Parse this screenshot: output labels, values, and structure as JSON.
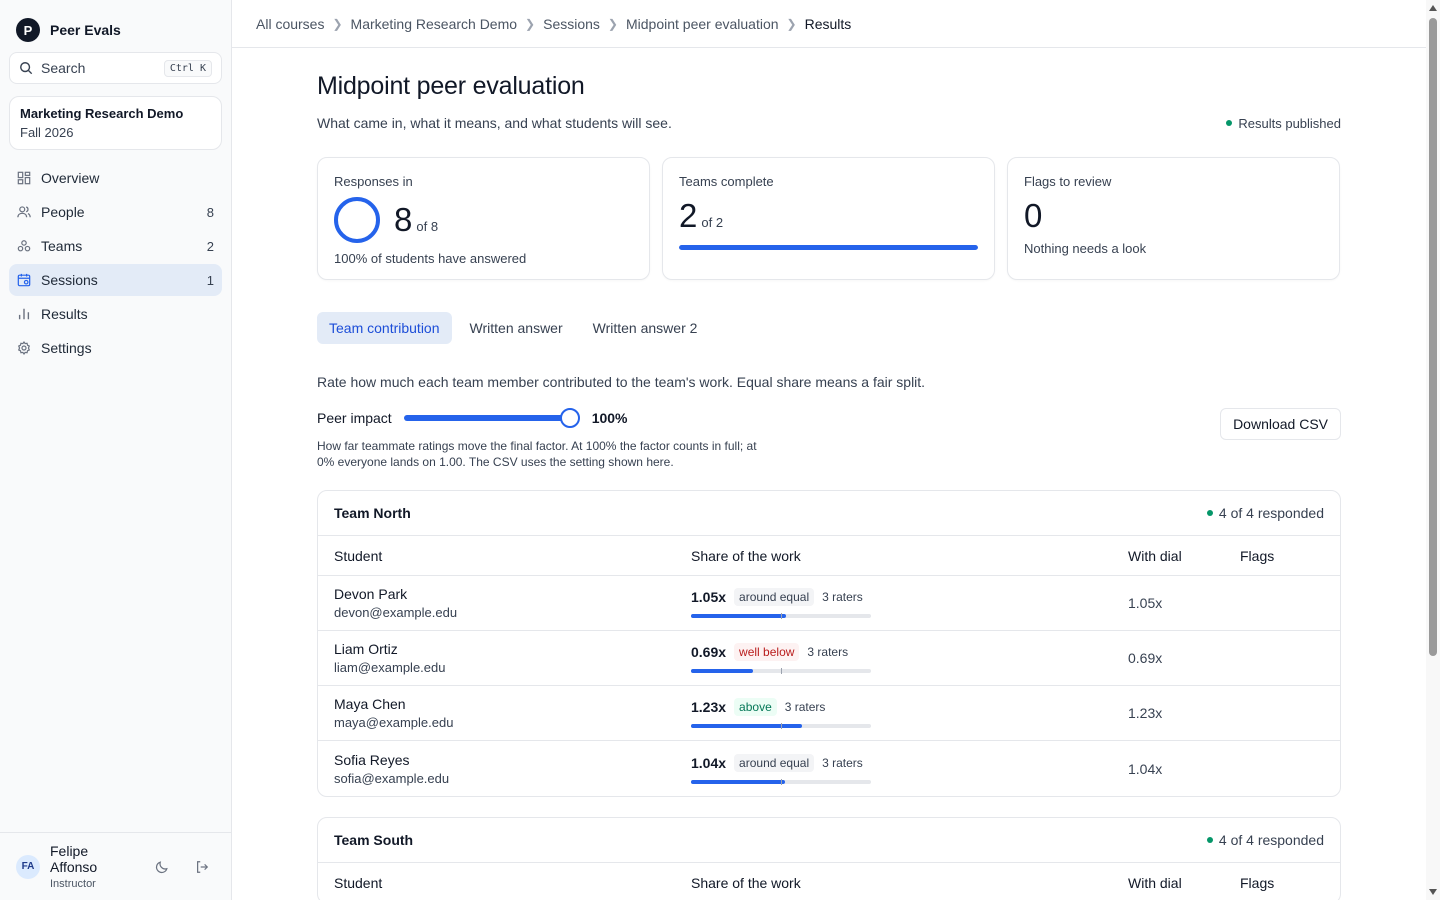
{
  "app": {
    "logo_letter": "P",
    "name": "Peer Evals"
  },
  "search": {
    "label": "Search",
    "shortcut": "Ctrl K"
  },
  "course": {
    "name": "Marketing Research Demo",
    "term": "Fall 2026"
  },
  "nav": [
    {
      "label": "Overview",
      "count": "",
      "icon": "grid-icon"
    },
    {
      "label": "People",
      "count": "8",
      "icon": "people-icon"
    },
    {
      "label": "Teams",
      "count": "2",
      "icon": "teams-icon"
    },
    {
      "label": "Sessions",
      "count": "1",
      "icon": "calendar-icon",
      "active": true
    },
    {
      "label": "Results",
      "count": "",
      "icon": "bar-chart-icon"
    },
    {
      "label": "Settings",
      "count": "",
      "icon": "gear-icon"
    }
  ],
  "user": {
    "initials": "FA",
    "name": "Felipe Affonso",
    "role": "Instructor"
  },
  "breadcrumbs": [
    "All courses",
    "Marketing Research Demo",
    "Sessions",
    "Midpoint peer evaluation",
    "Results"
  ],
  "page": {
    "title": "Midpoint peer evaluation",
    "subtitle": "What came in, what it means, and what students will see.",
    "status": "Results published"
  },
  "stats": {
    "responses": {
      "title": "Responses in",
      "value": "8",
      "of": "of 8",
      "foot": "100% of students have answered"
    },
    "teams": {
      "title": "Teams complete",
      "value": "2",
      "of": "of 2",
      "progress": 1.0
    },
    "flags": {
      "title": "Flags to review",
      "value": "0",
      "foot": "Nothing needs a look"
    }
  },
  "tabs": [
    "Team contribution",
    "Written answer",
    "Written answer 2"
  ],
  "instructions": "Rate how much each team member contributed to the team's work. Equal share means a fair split.",
  "impact": {
    "label": "Peer impact",
    "value": "100%",
    "level": 1.0,
    "help": "How far teammate ratings move the final factor. At 100% the factor counts in full; at 0% everyone lands on 1.00. The CSV uses the setting shown here.",
    "download": "Download CSV"
  },
  "columns": {
    "student": "Student",
    "share": "Share of the work",
    "dial": "With dial",
    "flags": "Flags"
  },
  "teams": [
    {
      "name": "Team North",
      "status": "4 of 4 responded",
      "students": [
        {
          "name": "Devon Park",
          "email": "devon@example.edu",
          "factor": "1.05x",
          "tag": "around equal",
          "tag_kind": "eq",
          "raters": "3 raters",
          "share": 0.525,
          "dial": "1.05x",
          "flags": ""
        },
        {
          "name": "Liam Ortiz",
          "email": "liam@example.edu",
          "factor": "0.69x",
          "tag": "well below",
          "tag_kind": "below",
          "raters": "3 raters",
          "share": 0.345,
          "dial": "0.69x",
          "flags": ""
        },
        {
          "name": "Maya Chen",
          "email": "maya@example.edu",
          "factor": "1.23x",
          "tag": "above",
          "tag_kind": "above",
          "raters": "3 raters",
          "share": 0.615,
          "dial": "1.23x",
          "flags": ""
        },
        {
          "name": "Sofia Reyes",
          "email": "sofia@example.edu",
          "factor": "1.04x",
          "tag": "around equal",
          "tag_kind": "eq",
          "raters": "3 raters",
          "share": 0.52,
          "dial": "1.04x",
          "flags": ""
        }
      ]
    },
    {
      "name": "Team South",
      "status": "4 of 4 responded",
      "students": []
    }
  ]
}
